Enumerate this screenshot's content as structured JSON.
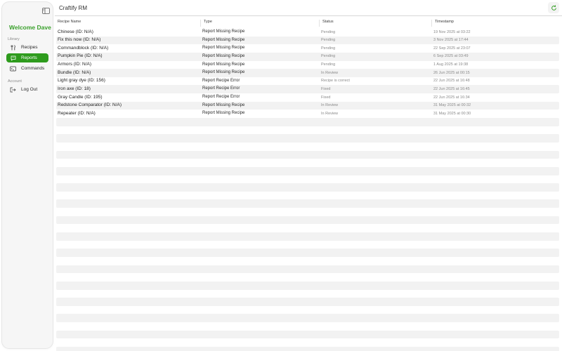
{
  "app": {
    "title": "Craftify RM"
  },
  "sidebar": {
    "welcome": "Welcome Dave",
    "sections": [
      {
        "label": "Library",
        "items": [
          {
            "label": "Recipes",
            "icon": "fork-knife-icon",
            "active": false
          },
          {
            "label": "Reports",
            "icon": "speech-bubble-icon",
            "active": true
          },
          {
            "label": "Commands",
            "icon": "terminal-icon",
            "active": false
          }
        ]
      },
      {
        "label": "Account",
        "items": [
          {
            "label": "Log Out",
            "icon": "logout-icon",
            "active": false
          }
        ]
      }
    ]
  },
  "table": {
    "columns": [
      "Recipe Name",
      "Type",
      "Status",
      "Timestamp"
    ],
    "rows": [
      {
        "name": "Chinese  (ID: N/A)",
        "type": "Report Missing Recipe",
        "status": "Pending",
        "timestamp": "19 Nov 2025 at 03:22"
      },
      {
        "name": "Fix this now (ID: N/A)",
        "type": "Report Missing Recipe",
        "status": "Pending",
        "timestamp": "3 Nov 2025 at 17:44"
      },
      {
        "name": "Commandblock  (ID: N/A)",
        "type": "Report Missing Recipe",
        "status": "Pending",
        "timestamp": "22 Sep 2025 at 23:07"
      },
      {
        "name": "Pumpkin Pie (ID: N/A)",
        "type": "Report Missing Recipe",
        "status": "Pending",
        "timestamp": "6 Sep 2025 at 03:49"
      },
      {
        "name": "Armors (ID: N/A)",
        "type": "Report Missing Recipe",
        "status": "Pending",
        "timestamp": "1 Aug 2025 at 19:38"
      },
      {
        "name": "Bundle  (ID: N/A)",
        "type": "Report Missing Recipe",
        "status": "In Review",
        "timestamp": "26 Jun 2025 at 00:15"
      },
      {
        "name": "Light gray dye (ID: 156)",
        "type": "Report Recipe Error",
        "status": "Recipe is correct",
        "timestamp": "22 Jun 2025 at 16:48"
      },
      {
        "name": "Iron axe (ID: 18)",
        "type": "Report Recipe Error",
        "status": "Fixed",
        "timestamp": "22 Jun 2025 at 16:45"
      },
      {
        "name": "Gray Candle (ID: 195)",
        "type": "Report Recipe Error",
        "status": "Fixed",
        "timestamp": "22 Jun 2025 at 16:34"
      },
      {
        "name": "Redstone Comparator (ID: N/A)",
        "type": "Report Missing Recipe",
        "status": "In Review",
        "timestamp": "31 May 2025 at 00:32"
      },
      {
        "name": "Repeater (ID: N/A)",
        "type": "Report Missing Recipe",
        "status": "In Review",
        "timestamp": "31 May 2025 at 00:30"
      }
    ]
  },
  "colors": {
    "accent": "#2e9b1d",
    "welcome": "#3aa02c",
    "stripe": "#f2f2f2",
    "muted_text": "#8a8a8a"
  },
  "icons": {
    "sidebar_toggle": "sidebar-toggle-icon",
    "refresh": "refresh-icon"
  }
}
